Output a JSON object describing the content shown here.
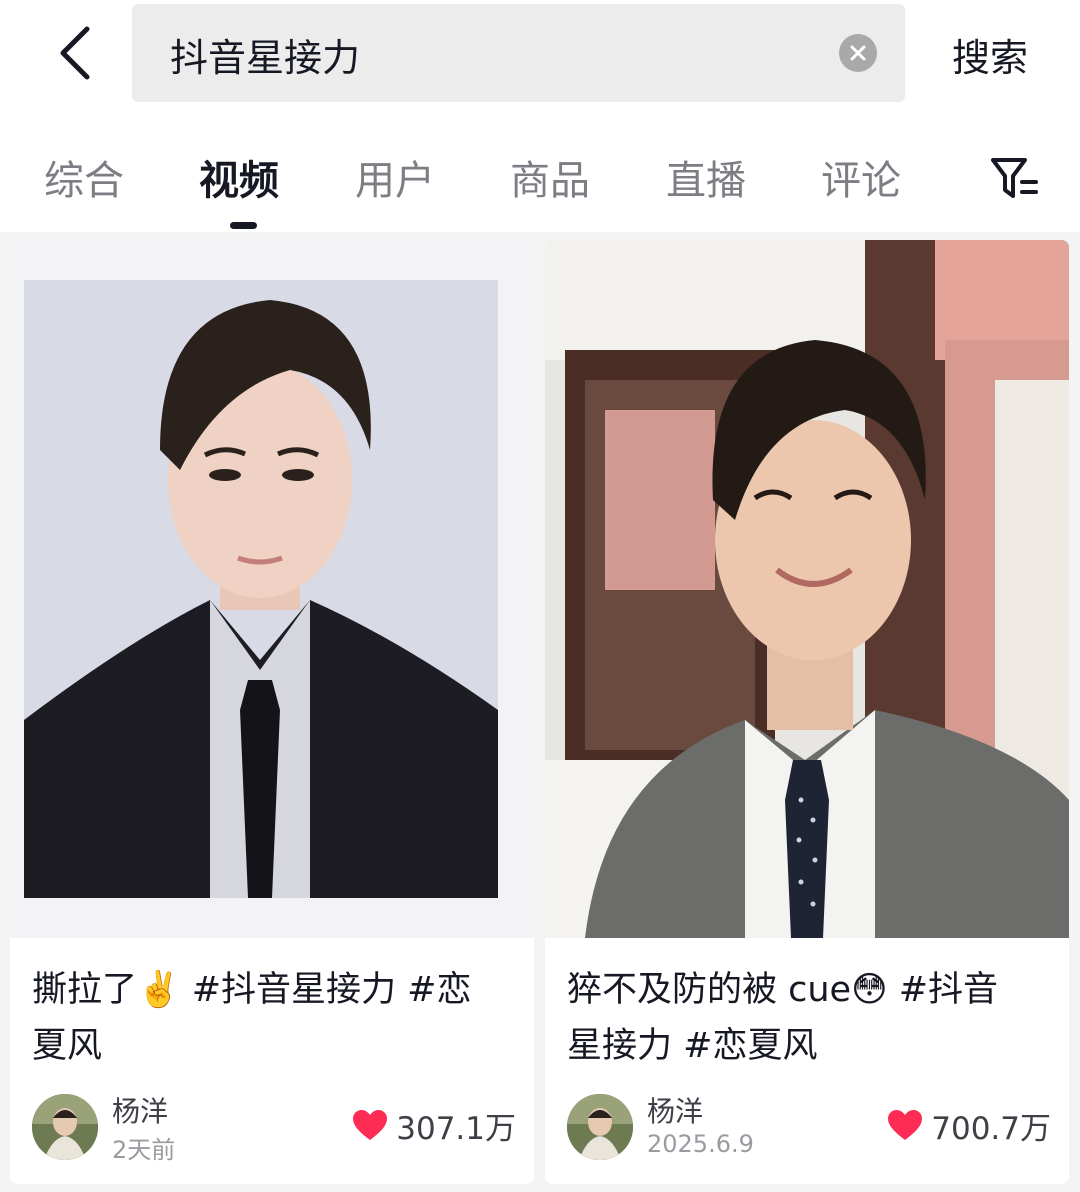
{
  "search": {
    "query": "抖音星接力",
    "submit_label": "搜索"
  },
  "tabs": [
    {
      "label": "综合",
      "active": false
    },
    {
      "label": "视频",
      "active": true
    },
    {
      "label": "用户",
      "active": false
    },
    {
      "label": "商品",
      "active": false
    },
    {
      "label": "直播",
      "active": false
    },
    {
      "label": "评论",
      "active": false
    }
  ],
  "colors": {
    "like_red": "#fe2c55",
    "text_primary": "#161823",
    "text_secondary": "#7d7e84"
  },
  "videos": [
    {
      "caption_line1": "撕拉了✌️ #抖音星接力 #恋",
      "caption_line2": "夏风",
      "author": "杨洋",
      "time": "2天前",
      "likes": "307.1万"
    },
    {
      "caption_line1": "猝不及防的被 cue😳 #抖音",
      "caption_line2": "星接力 #恋夏风",
      "author": "杨洋",
      "time": "2025.6.9",
      "likes": "700.7万"
    }
  ]
}
